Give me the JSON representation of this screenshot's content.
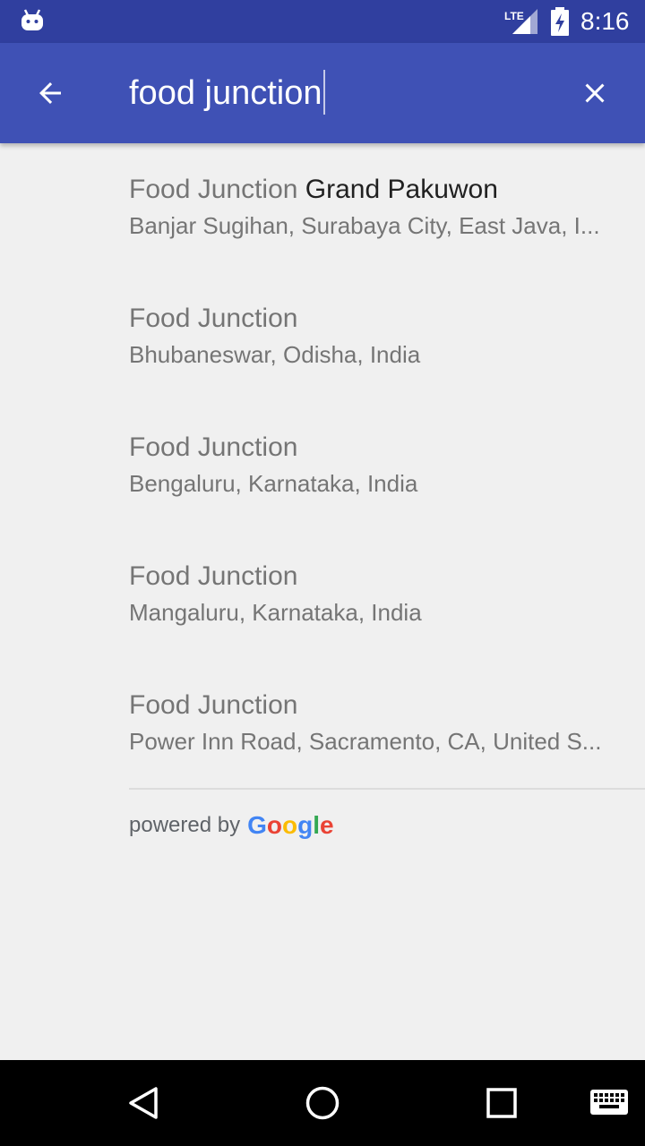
{
  "status_bar": {
    "network": "LTE",
    "time": "8:16"
  },
  "search": {
    "query": "food junction"
  },
  "results": [
    {
      "match": "Food Junction",
      "rest": " Grand Pakuwon",
      "address": "Banjar Sugihan, Surabaya City, East Java, I..."
    },
    {
      "match": "Food Junction",
      "rest": "",
      "address": "Bhubaneswar, Odisha, India"
    },
    {
      "match": "Food Junction",
      "rest": "",
      "address": "Bengaluru, Karnataka, India"
    },
    {
      "match": "Food Junction",
      "rest": "",
      "address": "Mangaluru, Karnataka, India"
    },
    {
      "match": "Food Junction",
      "rest": "",
      "address": "Power Inn Road, Sacramento, CA, United S..."
    }
  ],
  "attribution": {
    "powered_by": "powered by",
    "google": {
      "G": "G",
      "o1": "o",
      "o2": "o",
      "g": "g",
      "l": "l",
      "e": "e"
    }
  },
  "colors": {
    "status_bar": "#303f9f",
    "app_bar": "#3f51b5",
    "google_blue": "#4285f4",
    "google_red": "#ea4335",
    "google_yellow": "#fbbc05",
    "google_green": "#34a853"
  },
  "icons": {
    "back": "arrow-back-icon",
    "clear": "close-icon",
    "nav_back": "triangle-back-icon",
    "nav_home": "circle-home-icon",
    "nav_recents": "square-recents-icon",
    "keyboard": "keyboard-icon"
  }
}
